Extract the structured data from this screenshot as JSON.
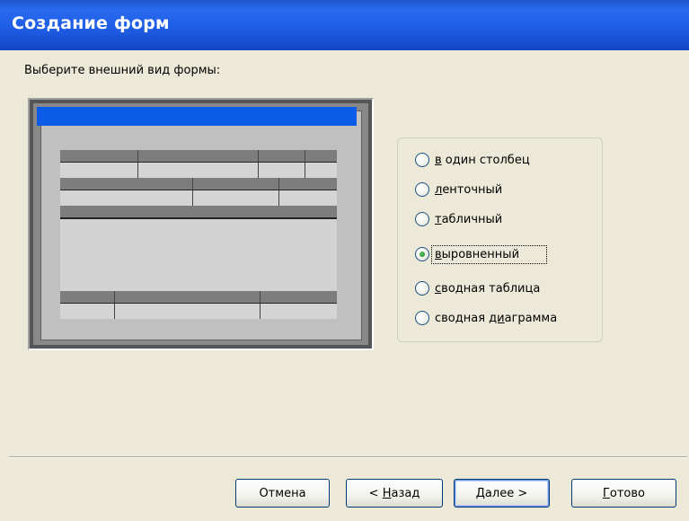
{
  "window": {
    "title": "Создание форм"
  },
  "prompt": "Выберите внешний вид формы:",
  "options": [
    {
      "pre": "",
      "u": "в",
      "post": " один столбец",
      "checked": false
    },
    {
      "pre": "",
      "u": "л",
      "post": "енточный",
      "checked": false
    },
    {
      "pre": "",
      "u": "т",
      "post": "абличный",
      "checked": false
    },
    {
      "pre": "",
      "u": "в",
      "post": "ыровненный",
      "checked": true
    },
    {
      "pre": "",
      "u": "с",
      "post": "водная таблица",
      "checked": false
    },
    {
      "pre": "сводная ",
      "u": "ди",
      "post": "аграмма",
      "checked": false
    }
  ],
  "buttons": {
    "cancel": {
      "label": "Отмена"
    },
    "back": {
      "pre": "< ",
      "u": "Н",
      "post": "азад"
    },
    "next": {
      "pre": "",
      "u": "Д",
      "post": "алее >"
    },
    "finish": {
      "pre": "",
      "u": "Г",
      "post": "отово"
    }
  },
  "colors": {
    "titlebar": "#1e5ee6",
    "dialog": "#ece9d8",
    "preview_title": "#0a5ce7"
  }
}
